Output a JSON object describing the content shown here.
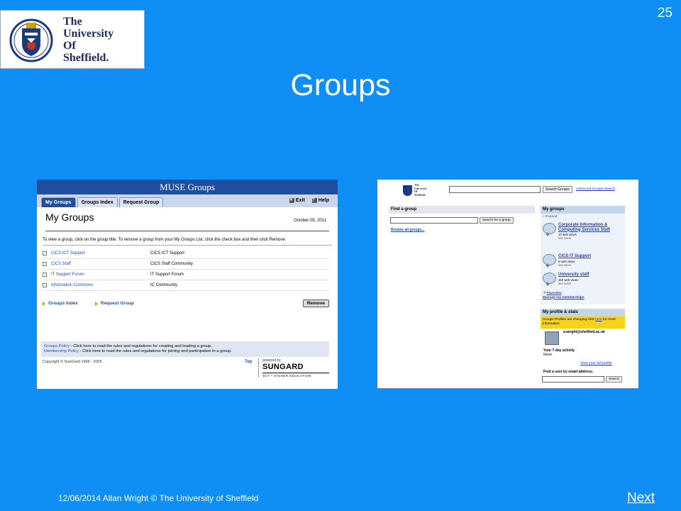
{
  "slide": {
    "number": "25",
    "title": "Groups",
    "footer": "12/06/2014  Allan Wright © The University of Sheffield",
    "next_label": "Next",
    "background": "#0f8ef5"
  },
  "logo": {
    "line1": "The",
    "line2": "University",
    "line3": "Of",
    "line4": "Sheffield."
  },
  "muse": {
    "header": "MUSE Groups",
    "tabs": [
      {
        "label": "My Groups",
        "active": true
      },
      {
        "label": "Groups Index",
        "active": false
      },
      {
        "label": "Request Group",
        "active": false
      }
    ],
    "exit_label": "Exit",
    "help_label": "Help",
    "page_title": "My Groups",
    "date": "October 05, 2011",
    "instructions": "To view a group, click on the group title. To remove a group from your My Groups List, click the check box and then click Remove.",
    "groups": [
      {
        "name": "CiCS ICT Support",
        "description": "CiCS ICT Support"
      },
      {
        "name": "CiCS Staff",
        "description": "CiCS Staff Community"
      },
      {
        "name": "IT Support Forum",
        "description": "IT Support Forum"
      },
      {
        "name": "Information Commons",
        "description": "IC Community"
      }
    ],
    "groups_index_link": "Groups Index",
    "request_group_link": "Request Group",
    "remove_button": "Remove",
    "groups_policy_link": "Groups Policy",
    "groups_policy_text": " - Click here to read the rules and regulations for creating and leading a group.",
    "membership_policy_link": "Membership Policy",
    "membership_policy_text": " - Click here to read the rules and regulations for joining and participation in a group.",
    "copyright": "Copyright © SunGard 1998 - 2005.",
    "top_link": "Top",
    "powered_by": "powered by",
    "sungard": "SUNGARD",
    "sct": "SCT • HIGHER EDUCATION"
  },
  "shef": {
    "logo_line1": "The",
    "logo_line2": "University",
    "logo_line3": "Of",
    "logo_line4": "Sheffield.",
    "search_button": "Search Groups",
    "advanced_link": "Advanced Groups Search",
    "find_group_heading": "Find a group",
    "find_group_button": "Search for a group",
    "browse_link": "Browse all groups...",
    "my_groups_heading": "My groups",
    "expand_link": "+ Expand",
    "groups": [
      {
        "name": "Corporate Information & Computing Services Staff",
        "views": "13 web views",
        "period": "last week"
      },
      {
        "name": "CiCS IT Support",
        "views": "5 web views",
        "period": "last week"
      },
      {
        "name": "University staff",
        "views": "150 web views",
        "period": "last week"
      }
    ],
    "favorites_link": "Favorites",
    "memberships_link": "Manage my memberships",
    "profile_heading": "My profile & stats",
    "notice_text": "Groups Profiles are changing click ",
    "notice_link": "here",
    "notice_text2": " for more information.",
    "email": "a.wright@sheffield.ac.uk",
    "activity_label": "Your 7-day activity",
    "activity_value": "None",
    "full_profile_link": "View your full profile",
    "find_user_label": "Find a user by email address:",
    "search_button_small": "Search"
  }
}
